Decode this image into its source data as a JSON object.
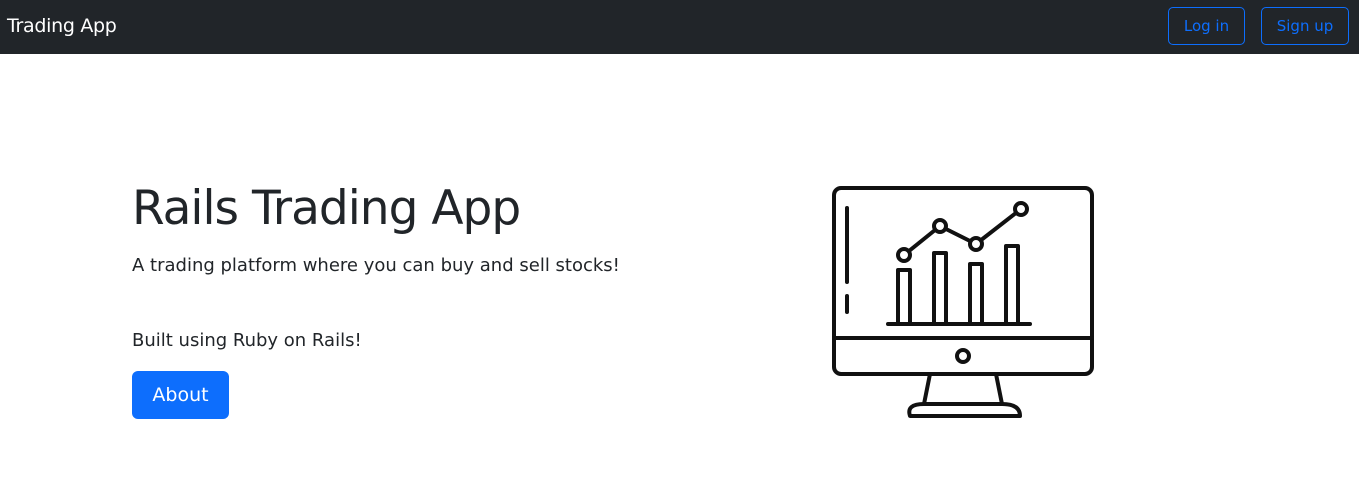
{
  "navbar": {
    "brand": "Trading App",
    "login_label": "Log in",
    "signup_label": "Sign up"
  },
  "hero": {
    "title": "Rails Trading App",
    "description": "A trading platform where you can buy and sell stocks!",
    "built_with": "Built using Ruby on Rails!",
    "about_label": "About",
    "illustration_icon": "monitor-chart-icon"
  },
  "colors": {
    "navbar_bg": "#212529",
    "primary": "#0d6efd",
    "text": "#212529"
  }
}
